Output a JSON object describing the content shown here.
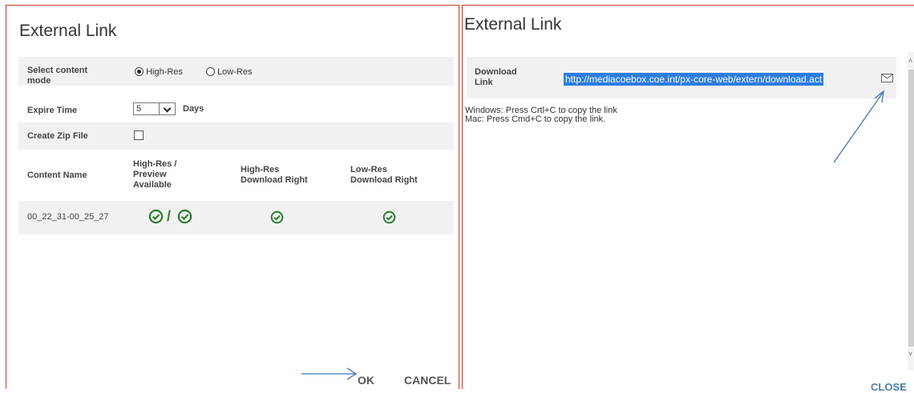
{
  "left_dialog": {
    "title": "External Link",
    "content_mode": {
      "label": "Select content mode",
      "options": [
        "High-Res",
        "Low-Res"
      ],
      "selected": "High-Res"
    },
    "expire_time": {
      "label": "Expire Time",
      "value": "5",
      "unit": "Days"
    },
    "zip": {
      "label": "Create Zip File",
      "checked": false
    },
    "table": {
      "headers": [
        "Content Name",
        "High-Res / Preview Available",
        "High-Res Download Right",
        "Low-Res Download Right"
      ],
      "rows": [
        {
          "name": "00_22_31-00_25_27",
          "separator": "/"
        }
      ]
    },
    "buttons": {
      "ok": "OK",
      "cancel": "CANCEL"
    }
  },
  "right_dialog": {
    "title": "External Link",
    "download_link": {
      "label": "Download Link",
      "url": "http://mediacoebox.coe.int/px-core-web/extern/download.act"
    },
    "instructions": [
      "Windows: Press Crtl+C to copy the link",
      "Mac: Press Cmd+C to copy the link."
    ],
    "buttons": {
      "close": "CLOSE"
    }
  },
  "icons": [
    "radio-selected",
    "radio-unselected",
    "dropdown-arrow",
    "check-circle-icon",
    "mail-icon",
    "annotation-arrow"
  ],
  "colors": {
    "border_red": "#c0392b",
    "check_green": "#2e7d32",
    "selection_blue": "#2b7de1",
    "arrow_blue": "#3a6fb0",
    "close_blue": "#4a7fa3"
  }
}
